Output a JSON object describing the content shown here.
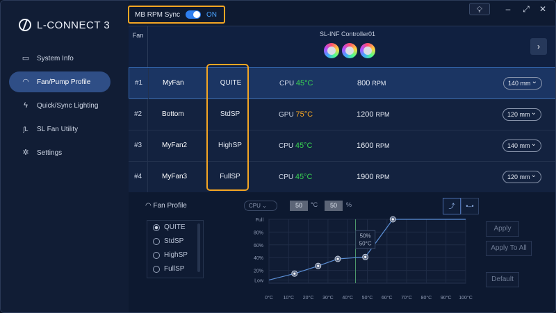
{
  "app": {
    "title": "L-CONNECT 3"
  },
  "sidebar": {
    "items": [
      {
        "label": "System Info",
        "icon": "monitor-icon"
      },
      {
        "label": "Fan/Pump Profile",
        "icon": "fan-gauge-icon"
      },
      {
        "label": "Quick/Sync Lighting",
        "icon": "lightning-icon"
      },
      {
        "label": "SL Fan Utility",
        "icon": "sl-icon"
      },
      {
        "label": "Settings",
        "icon": "gear-icon"
      }
    ],
    "active_index": 1
  },
  "sync": {
    "label": "MB RPM Sync",
    "state": "ON"
  },
  "window": {
    "minimize": "–",
    "maximize": "⤢",
    "close": "✕",
    "bulb_icon": "lightbulb-icon"
  },
  "header": {
    "fan_col": "Fan",
    "controller": "SL-INF Controller01",
    "next": "›"
  },
  "rows": [
    {
      "num": "#1",
      "name": "MyFan",
      "profile": "QUITE",
      "sensor": "CPU",
      "temp": "45°C",
      "temp_color": "#39d353",
      "rpm": "800",
      "rpm_unit": "RPM",
      "size": "140 mm"
    },
    {
      "num": "#2",
      "name": "Bottom",
      "profile": "StdSP",
      "sensor": "GPU",
      "temp": "75°C",
      "temp_color": "#f5a623",
      "rpm": "1200",
      "rpm_unit": "RPM",
      "size": "120 mm"
    },
    {
      "num": "#3",
      "name": "MyFan2",
      "profile": "HighSP",
      "sensor": "CPU",
      "temp": "45°C",
      "temp_color": "#39d353",
      "rpm": "1600",
      "rpm_unit": "RPM",
      "size": "140 mm"
    },
    {
      "num": "#4",
      "name": "MyFan3",
      "profile": "FullSP",
      "sensor": "CPU",
      "temp": "45°C",
      "temp_color": "#39d353",
      "rpm": "1900",
      "rpm_unit": "RPM",
      "size": "120 mm"
    }
  ],
  "fan_profile": {
    "title": "Fan Profile",
    "options": [
      "QUITE",
      "StdSP",
      "HighSP",
      "FullSP"
    ],
    "selected": "QUITE",
    "source": "CPU",
    "temp_value": "50",
    "temp_unit": "°C",
    "pct_value": "50",
    "pct_unit": "%",
    "apply": "Apply",
    "apply_all": "Apply To All",
    "default": "Default"
  },
  "chart_data": {
    "type": "line",
    "x_ticks": [
      "0°C",
      "10°C",
      "20°C",
      "30°C",
      "40°C",
      "50°C",
      "60°C",
      "70°C",
      "80°C",
      "90°C",
      "100°C"
    ],
    "y_ticks": [
      "Full",
      "80%",
      "60%",
      "40%",
      "20%",
      "Low"
    ],
    "points": [
      [
        0,
        5
      ],
      [
        13,
        15
      ],
      [
        25,
        27
      ],
      [
        35,
        38
      ],
      [
        49,
        41
      ],
      [
        63,
        100
      ],
      [
        100,
        100
      ]
    ],
    "cursor_x": 44,
    "tooltip": [
      "50%",
      "50°C"
    ]
  }
}
